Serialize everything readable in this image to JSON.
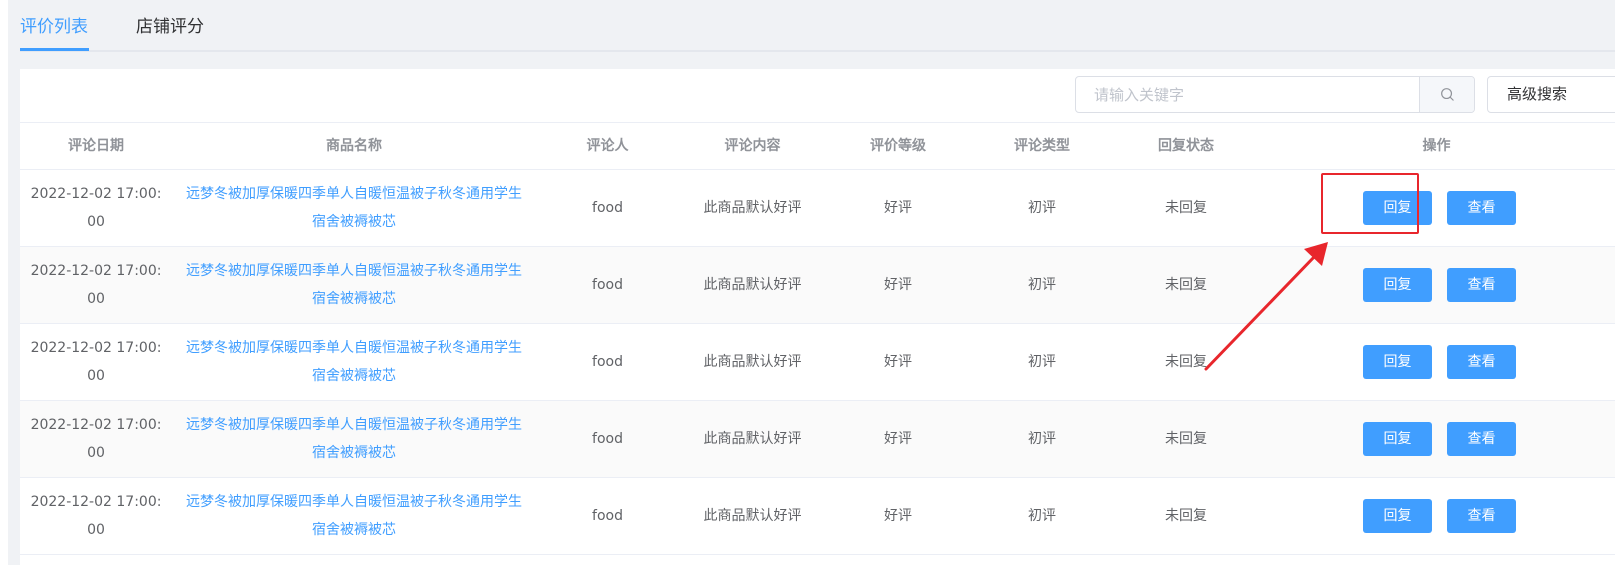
{
  "tabs": [
    {
      "label": "评价列表",
      "active": true
    },
    {
      "label": "店铺评分",
      "active": false
    }
  ],
  "search": {
    "placeholder": "请输入关键字",
    "advanced_label": "高级搜索"
  },
  "table": {
    "columns": [
      "评论日期",
      "商品名称",
      "评论人",
      "评论内容",
      "评价等级",
      "评论类型",
      "回复状态",
      "操作"
    ],
    "rows": [
      {
        "date": "2022-12-02 17:00:00",
        "product": "远梦冬被加厚保暖四季单人自暖恒温被子秋冬通用学生宿舍被褥被芯",
        "reviewer": "food",
        "content": "此商品默认好评",
        "rating": "好评",
        "type": "初评",
        "reply_status": "未回复",
        "reply_label": "回复",
        "view_label": "查看"
      },
      {
        "date": "2022-12-02 17:00:00",
        "product": "远梦冬被加厚保暖四季单人自暖恒温被子秋冬通用学生宿舍被褥被芯",
        "reviewer": "food",
        "content": "此商品默认好评",
        "rating": "好评",
        "type": "初评",
        "reply_status": "未回复",
        "reply_label": "回复",
        "view_label": "查看"
      },
      {
        "date": "2022-12-02 17:00:00",
        "product": "远梦冬被加厚保暖四季单人自暖恒温被子秋冬通用学生宿舍被褥被芯",
        "reviewer": "food",
        "content": "此商品默认好评",
        "rating": "好评",
        "type": "初评",
        "reply_status": "未回复",
        "reply_label": "回复",
        "view_label": "查看"
      },
      {
        "date": "2022-12-02 17:00:00",
        "product": "远梦冬被加厚保暖四季单人自暖恒温被子秋冬通用学生宿舍被褥被芯",
        "reviewer": "food",
        "content": "此商品默认好评",
        "rating": "好评",
        "type": "初评",
        "reply_status": "未回复",
        "reply_label": "回复",
        "view_label": "查看"
      },
      {
        "date": "2022-12-02 17:00:00",
        "product": "远梦冬被加厚保暖四季单人自暖恒温被子秋冬通用学生宿舍被褥被芯",
        "reviewer": "food",
        "content": "此商品默认好评",
        "rating": "好评",
        "type": "初评",
        "reply_status": "未回复",
        "reply_label": "回复",
        "view_label": "查看"
      }
    ]
  },
  "icons": {
    "search": "search-icon",
    "arrow": "annotation-arrow-icon"
  },
  "colors": {
    "accent": "#409eff",
    "annotation": "#e8262c"
  }
}
